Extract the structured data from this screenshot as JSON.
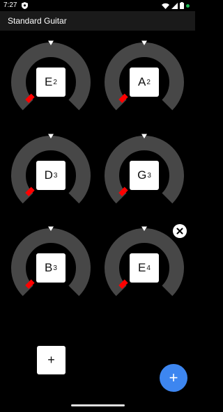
{
  "status_bar": {
    "time": "7:27",
    "icons": [
      "shield-icon",
      "wifi-icon",
      "signal-icon",
      "battery-icon",
      "notification-dot-icon"
    ]
  },
  "app_bar": {
    "title": "Standard Guitar"
  },
  "tuners": [
    {
      "note": "E",
      "octave": "2",
      "indicator_color": "#ff0000"
    },
    {
      "note": "A",
      "octave": "2",
      "indicator_color": "#ff0000"
    },
    {
      "note": "D",
      "octave": "3",
      "indicator_color": "#ff0000"
    },
    {
      "note": "G",
      "octave": "3",
      "indicator_color": "#ff0000"
    },
    {
      "note": "B",
      "octave": "3",
      "indicator_color": "#ff0000"
    },
    {
      "note": "E",
      "octave": "4",
      "indicator_color": "#ff0000"
    }
  ],
  "actions": {
    "add_string_label": "+",
    "fab_label": "+",
    "remove_icon": "close-icon"
  },
  "colors": {
    "background": "#000000",
    "app_bar": "#1a1a1a",
    "dial_track": "#474747",
    "indicator": "#ff0000",
    "fab": "#3d86f0",
    "accent_dot": "#1db954"
  }
}
